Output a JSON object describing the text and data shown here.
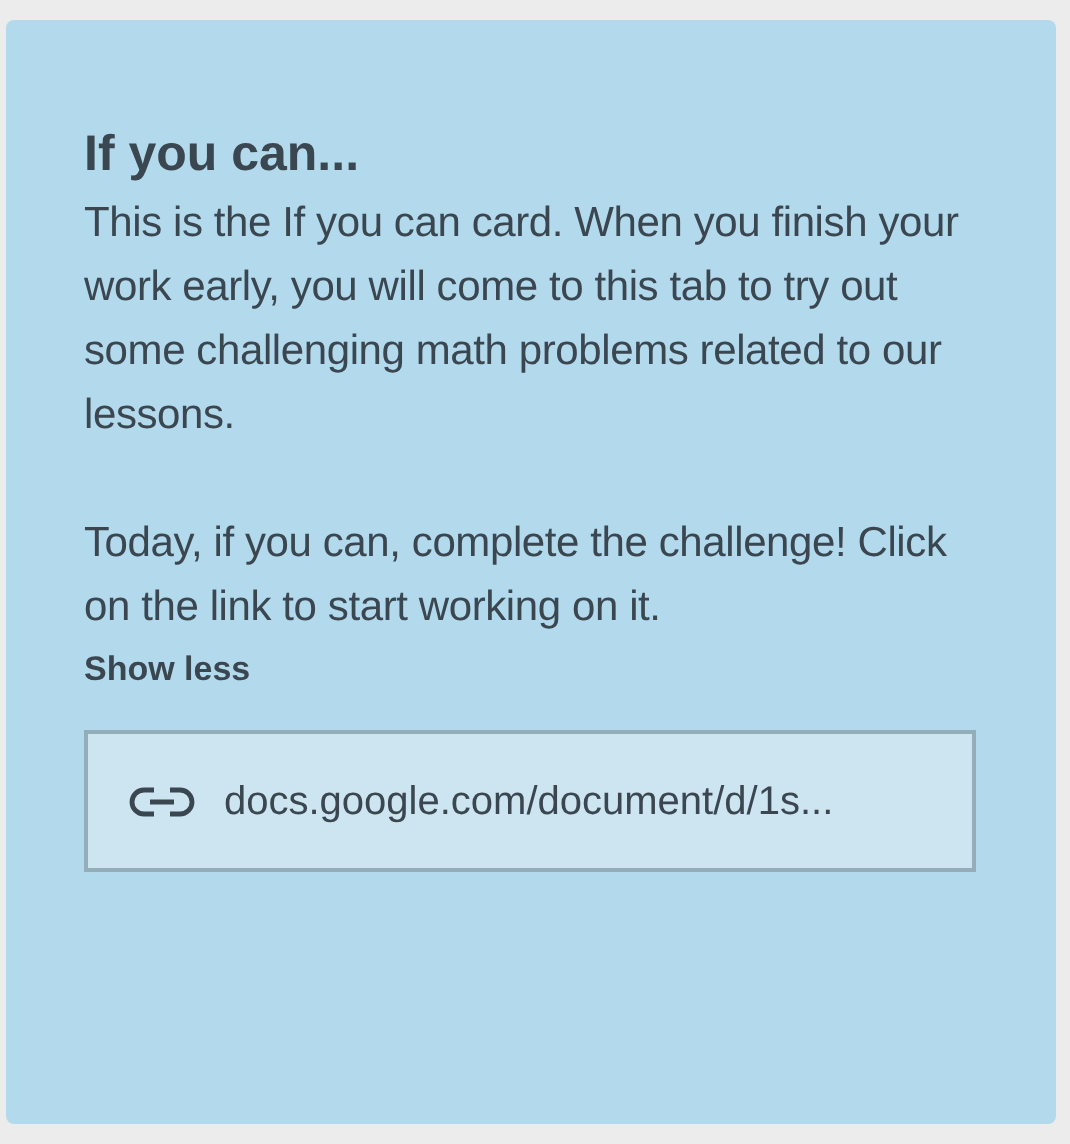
{
  "card": {
    "title": "If you can...",
    "paragraphs": [
      "This is the If you can card. When you finish your work early, you will come to this tab to try out some challenging math problems related to our lessons.",
      "Today, if you can, complete the challenge! Click on the link to start working on it."
    ],
    "toggle": "Show less",
    "link": {
      "text": "docs.google.com/document/d/1s..."
    }
  }
}
